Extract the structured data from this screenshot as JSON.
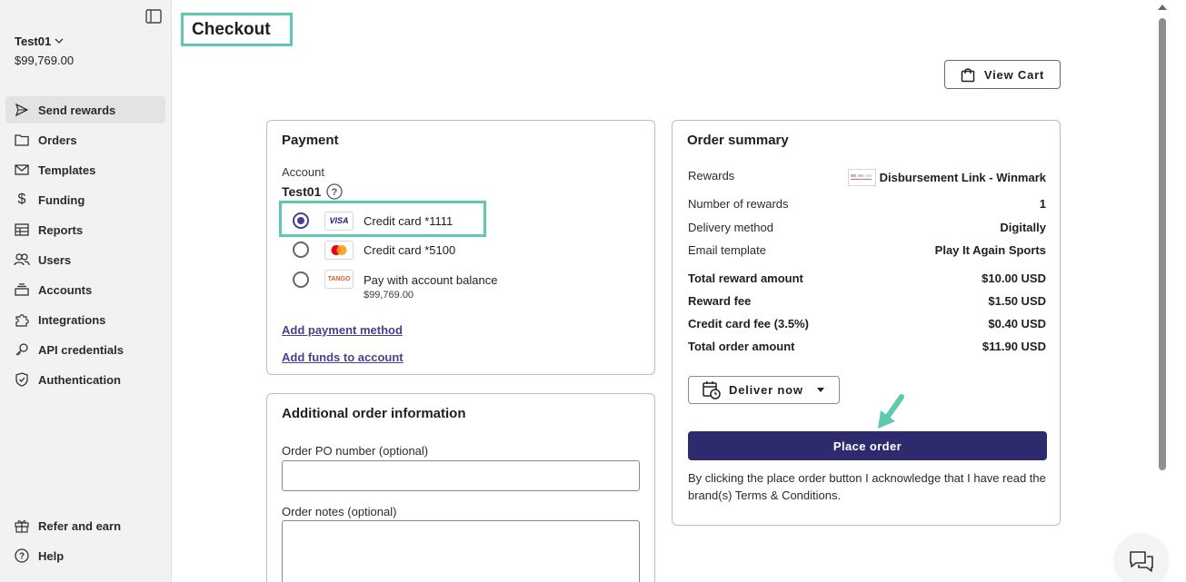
{
  "sidebar": {
    "account_name": "Test01",
    "account_balance": "$99,769.00",
    "items": [
      {
        "label": "Send rewards",
        "icon": "send-icon"
      },
      {
        "label": "Orders",
        "icon": "folder-icon"
      },
      {
        "label": "Templates",
        "icon": "envelope-icon"
      },
      {
        "label": "Funding",
        "icon": "dollar-icon"
      },
      {
        "label": "Reports",
        "icon": "table-icon"
      },
      {
        "label": "Users",
        "icon": "users-icon"
      },
      {
        "label": "Accounts",
        "icon": "stack-icon"
      },
      {
        "label": "Integrations",
        "icon": "puzzle-icon"
      },
      {
        "label": "API credentials",
        "icon": "key-icon"
      },
      {
        "label": "Authentication",
        "icon": "shield-icon"
      }
    ],
    "bottom_items": [
      {
        "label": "Refer and earn",
        "icon": "gift-icon"
      },
      {
        "label": "Help",
        "icon": "help-icon"
      }
    ]
  },
  "page": {
    "title": "Checkout",
    "view_cart_label": "View Cart"
  },
  "payment": {
    "title": "Payment",
    "account_label": "Account",
    "account_name": "Test01",
    "options": [
      {
        "label": "Credit card *1111",
        "brand": "VISA",
        "selected": true
      },
      {
        "label": "Credit card *5100",
        "brand": "mastercard",
        "selected": false
      },
      {
        "label": "Pay with account balance",
        "brand": "TANGO",
        "sub": "$99,769.00",
        "selected": false
      }
    ],
    "add_payment_link": "Add payment method",
    "add_funds_link": "Add funds to account"
  },
  "additional": {
    "title": "Additional order information",
    "po_label": "Order PO number (optional)",
    "notes_label": "Order notes (optional)"
  },
  "summary": {
    "title": "Order summary",
    "rows": [
      {
        "k": "Rewards",
        "v": "Disbursement Link - Winmark"
      },
      {
        "k": "Number of rewards",
        "v": "1"
      },
      {
        "k": "Delivery method",
        "v": "Digitally"
      },
      {
        "k": "Email template",
        "v": "Play It Again Sports"
      },
      {
        "k": "Total reward amount",
        "v": "$10.00 USD"
      },
      {
        "k": "Reward fee",
        "v": "$1.50 USD"
      },
      {
        "k": "Credit card fee (3.5%)",
        "v": "$0.40 USD"
      },
      {
        "k": "Total order amount",
        "v": "$11.90 USD"
      }
    ],
    "deliver_label": "Deliver now",
    "place_order_label": "Place order",
    "disclaimer": "By clicking the place order button I acknowledge that I have read the brand(s) Terms & Conditions."
  },
  "colors": {
    "accent": "#2e2a6e",
    "highlight": "#5fc8b0",
    "link": "#4a3f8f"
  }
}
